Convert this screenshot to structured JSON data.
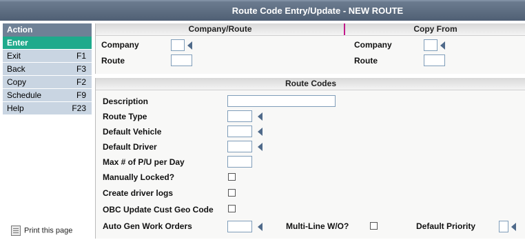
{
  "window": {
    "title": "Route Code Entry/Update - NEW ROUTE"
  },
  "sidebar": {
    "header": "Action",
    "items": [
      {
        "label": "Enter",
        "key": ""
      },
      {
        "label": "Exit",
        "key": "F1"
      },
      {
        "label": "Back",
        "key": "F3"
      },
      {
        "label": "Copy",
        "key": "F2"
      },
      {
        "label": "Schedule",
        "key": "F9"
      },
      {
        "label": "Help",
        "key": "F23"
      }
    ],
    "print_label": "Print this page"
  },
  "company_route": {
    "header": "Company/Route",
    "company_label": "Company",
    "company_value": "",
    "route_label": "Route",
    "route_value": ""
  },
  "copy_from": {
    "header": "Copy From",
    "company_label": "Company",
    "company_value": "",
    "route_label": "Route",
    "route_value": ""
  },
  "route_codes": {
    "header": "Route Codes",
    "description_label": "Description",
    "route_type_label": "Route Type",
    "default_vehicle_label": "Default Vehicle",
    "default_driver_label": "Default Driver",
    "max_pu_label": "Max # of P/U per Day",
    "manually_locked_label": "Manually Locked?",
    "create_driver_logs_label": "Create driver logs",
    "obc_update_label": "OBC Update Cust Geo Code",
    "auto_gen_label": "Auto Gen Work Orders",
    "multi_line_label": "Multi-Line W/O?",
    "default_priority_label": "Default Priority"
  },
  "colors": {
    "titlebar": "#5a6a80",
    "active_action": "#1faa8c",
    "sidebar_item": "#c9d5e2"
  }
}
